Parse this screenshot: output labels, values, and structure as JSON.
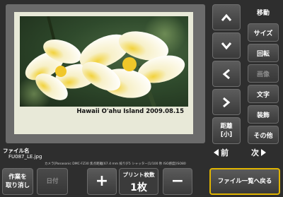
{
  "photo": {
    "caption": "Hawaii O'ahu Island  2009.08.15"
  },
  "side_menu": {
    "move": "移動",
    "size": "サイズ",
    "rotate": "回転",
    "image_quality": "画像",
    "text": "文字",
    "decoration": "装飾",
    "other": "その他"
  },
  "distance": {
    "line1": "距離",
    "line2": "[小]"
  },
  "file": {
    "label": "ファイル名",
    "name": "FU087_LE.jpg",
    "exif": "カメラ[Panasonic DMC-FZ30  焦点距離[67.4 mm  絞り[F5  シャッター[1/100 秒  ISO感度[ISO80"
  },
  "nav": {
    "prev": "前",
    "next": "次"
  },
  "bottom": {
    "undo_line1": "作業を",
    "undo_line2": "取り消し",
    "date": "日付",
    "plus": "+",
    "count_label": "プリント枚数",
    "count_value": "1枚",
    "minus": "−",
    "back": "ファイル一覧へ戻る"
  },
  "colors": {
    "background": "#2e2e2e",
    "paper": "#e8e9d8",
    "accent_border": "#e0b400"
  }
}
